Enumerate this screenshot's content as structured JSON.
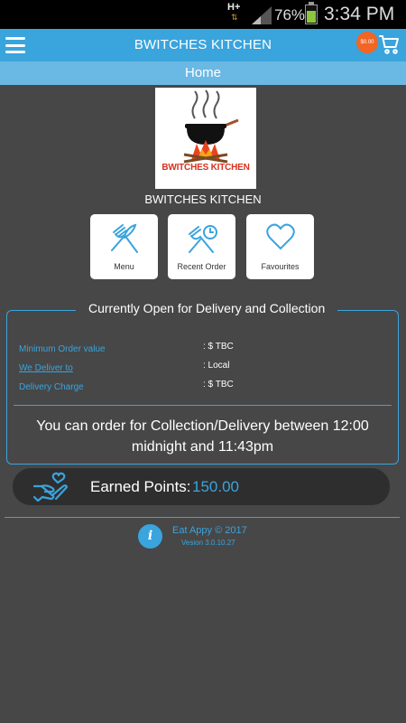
{
  "status_bar": {
    "network": "H+",
    "battery_percent": "76%",
    "battery_level": 0.76,
    "time": "3:34 PM"
  },
  "app_bar": {
    "title": "BWITCHES KITCHEN",
    "cart_total": "$0.00"
  },
  "sub_bar": {
    "title": "Home"
  },
  "logo": {
    "text": "BWITCHES KITCHEN"
  },
  "shop_name": "BWITCHES KITCHEN",
  "tiles": [
    {
      "label": "Menu",
      "icon": "fork-knife-icon"
    },
    {
      "label": "Recent Order",
      "icon": "recent-order-icon"
    },
    {
      "label": "Favourites",
      "icon": "heart-icon"
    }
  ],
  "info": {
    "heading": "Currently Open for Delivery and Collection",
    "rows": [
      {
        "label": "Minimum Order value",
        "value": ": $ TBC"
      },
      {
        "label": "We Deliver to",
        "value": ": Local"
      },
      {
        "label": "Delivery Charge",
        "value": ": $ TBC"
      }
    ],
    "note": "You can order for Collection/Delivery between 12:00 midnight and 11:43pm"
  },
  "points": {
    "label": "Earned Points:",
    "value": "150.00"
  },
  "footer": {
    "copyright": "Eat Appy © 2017",
    "version": "Vesion 3.0.10.27"
  },
  "colors": {
    "accent": "#3aa4dd",
    "background": "#474747",
    "badge": "#f26522"
  }
}
